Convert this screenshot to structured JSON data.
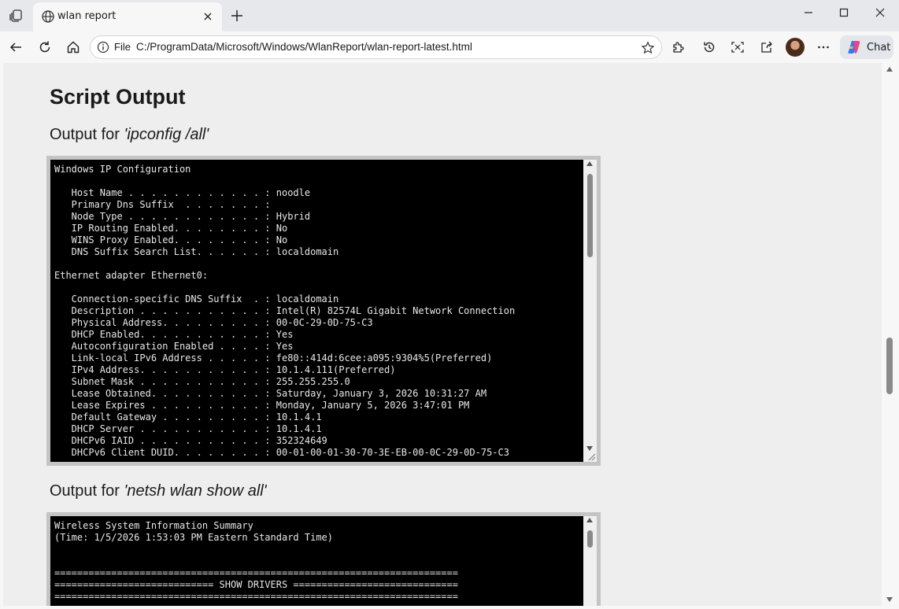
{
  "browser": {
    "tab": {
      "title": "wlan report"
    },
    "address": {
      "scheme_label": "File",
      "url": "C:/ProgramData/Microsoft/Windows/WlanReport/wlan-report-latest.html"
    },
    "chat_label": "Chat"
  },
  "page": {
    "heading": "Script Output",
    "sections": [
      {
        "label_prefix": "Output for ",
        "command": "'ipconfig /all'",
        "output": "Windows IP Configuration\n\n   Host Name . . . . . . . . . . . . : noodle\n   Primary Dns Suffix  . . . . . . . :\n   Node Type . . . . . . . . . . . . : Hybrid\n   IP Routing Enabled. . . . . . . . : No\n   WINS Proxy Enabled. . . . . . . . : No\n   DNS Suffix Search List. . . . . . : localdomain\n\nEthernet adapter Ethernet0:\n\n   Connection-specific DNS Suffix  . : localdomain\n   Description . . . . . . . . . . . : Intel(R) 82574L Gigabit Network Connection\n   Physical Address. . . . . . . . . : 00-0C-29-0D-75-C3\n   DHCP Enabled. . . . . . . . . . . : Yes\n   Autoconfiguration Enabled . . . . : Yes\n   Link-local IPv6 Address . . . . . : fe80::414d:6cee:a095:9304%5(Preferred)\n   IPv4 Address. . . . . . . . . . . : 10.1.4.111(Preferred)\n   Subnet Mask . . . . . . . . . . . : 255.255.255.0\n   Lease Obtained. . . . . . . . . . : Saturday, January 3, 2026 10:31:27 AM\n   Lease Expires . . . . . . . . . . : Monday, January 5, 2026 3:47:01 PM\n   Default Gateway . . . . . . . . . : 10.1.4.1\n   DHCP Server . . . . . . . . . . . : 10.1.4.1\n   DHCPv6 IAID . . . . . . . . . . . : 352324649\n   DHCPv6 Client DUID. . . . . . . . : 00-01-00-01-30-70-3E-EB-00-0C-29-0D-75-C3"
      },
      {
        "label_prefix": "Output for ",
        "command": "'netsh wlan show all'",
        "output": "Wireless System Information Summary\n(Time: 1/5/2026 1:53:03 PM Eastern Standard Time)\n\n\n=======================================================================\n============================ SHOW DRIVERS =============================\n======================================================================="
      }
    ]
  }
}
